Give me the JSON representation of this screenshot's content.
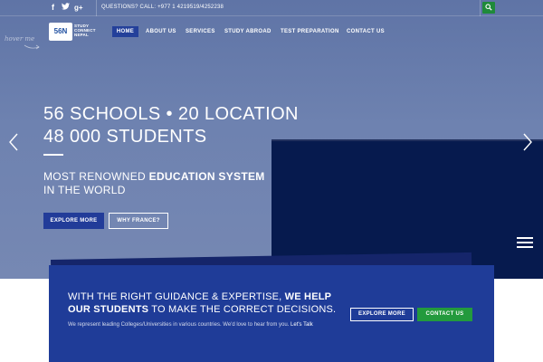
{
  "topbar": {
    "social": {
      "facebook": "f",
      "twitter": "t",
      "googleplus": "g+"
    },
    "phone_text": "QUESTIONS? CALL: +977 1 4219519/4252238"
  },
  "logo": {
    "badge": "56N",
    "line1": "STUDY",
    "line2": "CONNECT",
    "line3": "NEPAL"
  },
  "nav": {
    "items": [
      {
        "label": "HOME",
        "active": true
      },
      {
        "label": "ABOUT US"
      },
      {
        "label": "SERVICES"
      },
      {
        "label": "STUDY ABROAD"
      },
      {
        "label": "TEST PREPARATION"
      },
      {
        "label": "CONTACT US"
      }
    ]
  },
  "hero": {
    "scribble": "hover me",
    "headline_line1": "56 SCHOOLS • 20 LOCATION",
    "headline_line2": "48 000 STUDENTS",
    "tagline_line1_prefix": "MOST RENOWNED ",
    "tagline_line1_bold": "EDUCATION SYSTEM",
    "tagline_line2": "IN THE WORLD",
    "btn_primary": "EXPLORE MORE",
    "btn_outline": "WHY FRANCE?"
  },
  "cta": {
    "title_prefix": "WITH THE RIGHT GUIDANCE & EXPERTISE, ",
    "title_bold": "WE HELP OUR STUDENTS",
    "title_suffix": " TO MAKE THE CORRECT DECISIONS.",
    "subtitle": "We represent leading Colleges/Universities in various countries. We'd love to hear from you. ",
    "subtitle_link": "Let's Talk",
    "btn_explore": "EXPLORE MORE",
    "btn_contact": "CONTACT US"
  },
  "colors": {
    "hero_bg": "#6e82b0",
    "nav_active": "#24409a",
    "dark_panel": "#061a4e",
    "cta_bg": "#1f3c98",
    "green": "#239a3d"
  }
}
